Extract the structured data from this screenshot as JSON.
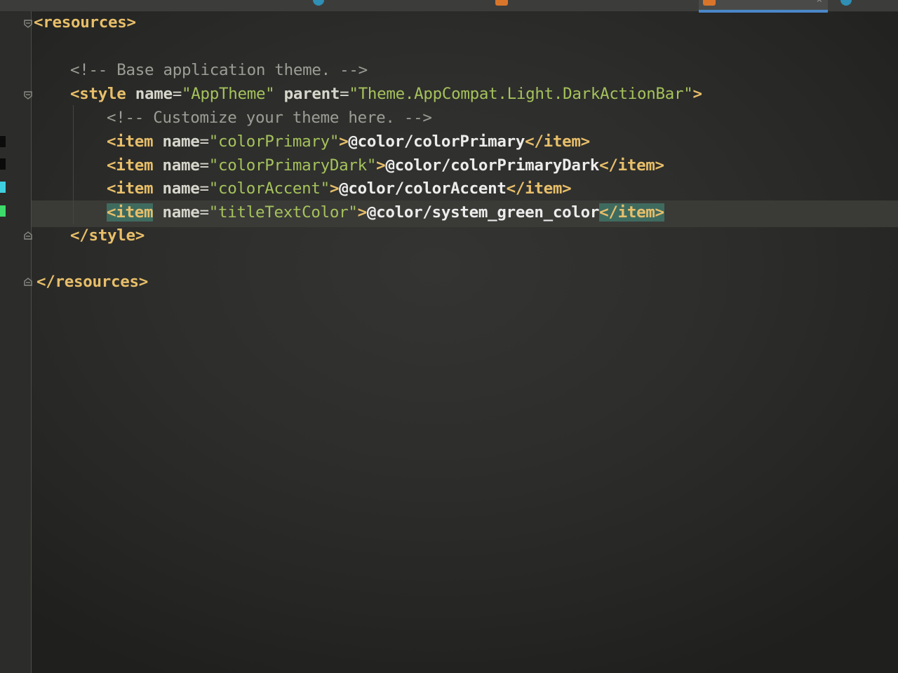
{
  "editor": {
    "lines": {
      "resources_open": "<resources>",
      "comment_base": "<!-- Base application theme. -->",
      "style_open_tag": "<style",
      "style_attr_name": " name",
      "style_eq1": "=",
      "style_name_value": "\"AppTheme\"",
      "style_attr_parent": " parent",
      "style_eq2": "=",
      "style_parent_value": "\"Theme.AppCompat.Light.DarkActionBar\"",
      "style_close_bracket": ">",
      "comment_customize": "<!-- Customize your theme here. -->",
      "style_close": "</style>",
      "resources_close": "</resources>"
    },
    "items": [
      {
        "open_tag": "<item",
        "attr": " name",
        "eq": "=",
        "name_value": "\"colorPrimary\"",
        "bracket": ">",
        "text": "@color/colorPrimary",
        "close_tag": "</item>"
      },
      {
        "open_tag": "<item",
        "attr": " name",
        "eq": "=",
        "name_value": "\"colorPrimaryDark\"",
        "bracket": ">",
        "text": "@color/colorPrimaryDark",
        "close_tag": "</item>"
      },
      {
        "open_tag": "<item",
        "attr": " name",
        "eq": "=",
        "name_value": "\"colorAccent\"",
        "bracket": ">",
        "text": "@color/colorAccent",
        "close_tag": "</item>"
      },
      {
        "open_tag": "<item",
        "attr": " name",
        "eq": "=",
        "name_value": "\"titleTextColor\"",
        "bracket": ">",
        "text": "@color/system_green_color",
        "close_tag": "</item>"
      }
    ],
    "gutter_colors": {
      "colorPrimary": "#0c0c0c",
      "colorPrimaryDark": "#0a0a0a",
      "colorAccent": "#3fd0e0",
      "titleTextColor": "#3ddc6a"
    },
    "icons": [
      "fold-open-icon",
      "fold-close-icon",
      "xml-file-icon",
      "close-tab-icon"
    ]
  },
  "tabs": {
    "active_close_label": "×"
  }
}
